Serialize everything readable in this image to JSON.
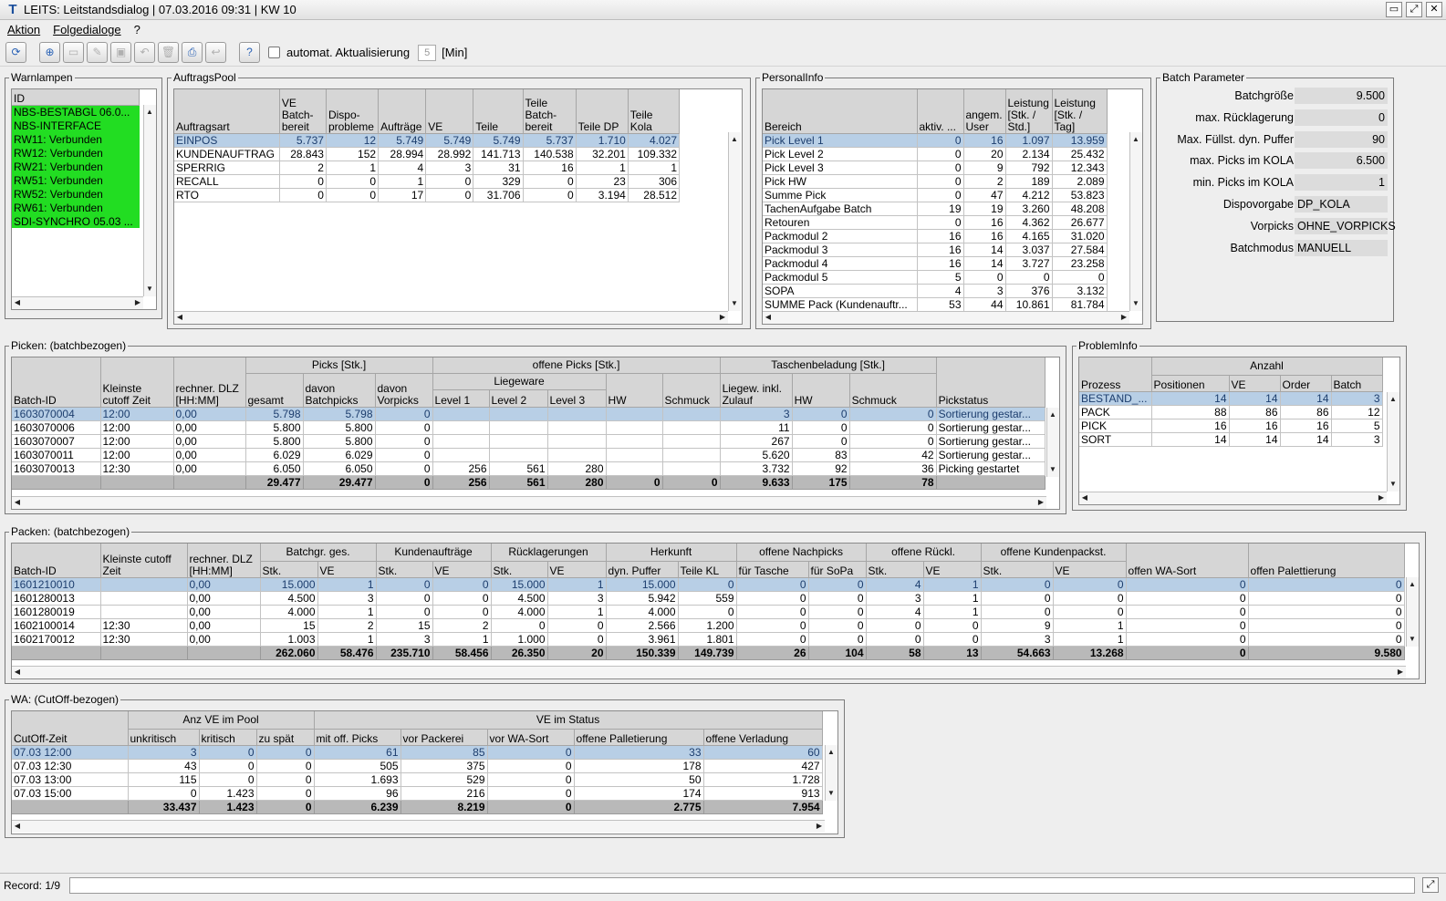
{
  "window": {
    "title": "LEITS: Leitstandsdialog | 07.03.2016 09:31 | KW 10"
  },
  "menu": [
    "Aktion",
    "Folgedialoge",
    "?"
  ],
  "toolbar": {
    "auto_label": "automat. Aktualisierung",
    "interval": "5",
    "unit": "[Min]",
    "buttons": [
      {
        "name": "refresh-icon",
        "glyph": "⟳",
        "enabled": true
      },
      {
        "name": "zoom-icon",
        "glyph": "⊕",
        "enabled": true
      },
      {
        "name": "new-doc-icon",
        "glyph": "▭",
        "enabled": false
      },
      {
        "name": "edit-icon",
        "glyph": "✎",
        "enabled": false
      },
      {
        "name": "save-icon",
        "glyph": "▣",
        "enabled": false
      },
      {
        "name": "undo-icon",
        "glyph": "↶",
        "enabled": false
      },
      {
        "name": "delete-icon",
        "glyph": "🗑",
        "enabled": false
      },
      {
        "name": "print-icon",
        "glyph": "⎙",
        "enabled": true
      },
      {
        "name": "link-icon",
        "glyph": "↩",
        "enabled": false
      },
      {
        "name": "help-icon",
        "glyph": "?",
        "enabled": true
      }
    ]
  },
  "warnlampen": {
    "title": "Warnlampen",
    "header": "ID",
    "items": [
      "NBS-BESTABGL 06.0...",
      "NBS-INTERFACE",
      "RW11: Verbunden",
      "RW12: Verbunden",
      "RW21: Verbunden",
      "RW51: Verbunden",
      "RW52: Verbunden",
      "RW61: Verbunden",
      "SDI-SYNCHRO 05.03 ..."
    ]
  },
  "auftragspool": {
    "title": "AuftragsPool",
    "headers": [
      "Auftragsart",
      "VE Batch-bereit",
      "Dispo-probleme",
      "Aufträge",
      "VE",
      "Teile",
      "Teile Batch-bereit",
      "Teile DP",
      "Teile Kola"
    ],
    "rows": [
      [
        "EINPOS",
        "5.737",
        "12",
        "5.749",
        "5.749",
        "5.749",
        "5.737",
        "1.710",
        "4.027"
      ],
      [
        "KUNDENAUFTRAG",
        "28.843",
        "152",
        "28.994",
        "28.992",
        "141.713",
        "140.538",
        "32.201",
        "109.332"
      ],
      [
        "SPERRIG",
        "2",
        "1",
        "4",
        "3",
        "31",
        "16",
        "1",
        "1"
      ],
      [
        "RECALL",
        "0",
        "0",
        "1",
        "0",
        "329",
        "0",
        "23",
        "306"
      ],
      [
        "RTO",
        "0",
        "0",
        "17",
        "0",
        "31.706",
        "0",
        "3.194",
        "28.512"
      ]
    ]
  },
  "personalinfo": {
    "title": "PersonalInfo",
    "headers": [
      "Bereich",
      "aktiv. ...",
      "angem. User",
      "Leistung [Stk. / Std.]",
      "Leistung [Stk. / Tag]"
    ],
    "rows": [
      [
        "Pick Level 1",
        "0",
        "16",
        "1.097",
        "13.959"
      ],
      [
        "Pick Level 2",
        "0",
        "20",
        "2.134",
        "25.432"
      ],
      [
        "Pick Level 3",
        "0",
        "9",
        "792",
        "12.343"
      ],
      [
        "Pick HW",
        "0",
        "2",
        "189",
        "2.089"
      ],
      [
        "Summe Pick",
        "0",
        "47",
        "4.212",
        "53.823"
      ],
      [
        "TachenAufgabe Batch",
        "19",
        "19",
        "3.260",
        "48.208"
      ],
      [
        "Retouren",
        "0",
        "16",
        "4.362",
        "26.677"
      ],
      [
        "Packmodul 2",
        "16",
        "16",
        "4.165",
        "31.020"
      ],
      [
        "Packmodul 3",
        "16",
        "14",
        "3.037",
        "27.584"
      ],
      [
        "Packmodul 4",
        "16",
        "14",
        "3.727",
        "23.258"
      ],
      [
        "Packmodul 5",
        "5",
        "0",
        "0",
        "0"
      ],
      [
        "SOPA",
        "4",
        "3",
        "376",
        "3.132"
      ],
      [
        "SUMME Pack (Kundenauftr...",
        "53",
        "44",
        "10.861",
        "81.784"
      ]
    ]
  },
  "batchparameter": {
    "title": "Batch Parameter",
    "rows": [
      [
        "Batchgröße",
        "9.500"
      ],
      [
        "max. Rücklagerung",
        "0"
      ],
      [
        "Max. Füllst. dyn. Puffer",
        "90"
      ],
      [
        "max. Picks im KOLA",
        "6.500"
      ],
      [
        "min. Picks im KOLA",
        "1"
      ],
      [
        "Dispovorgabe",
        "DP_KOLA"
      ],
      [
        "Vorpicks",
        "OHNE_VORPICKS"
      ],
      [
        "Batchmodus",
        "MANUELL"
      ]
    ]
  },
  "picken": {
    "title": "Picken: (batchbezogen)",
    "groups": {
      "picks": "Picks [Stk.]",
      "offene": "offene Picks [Stk.]",
      "liegeware": "Liegeware",
      "taschen": "Taschenbeladung [Stk.]"
    },
    "headers": [
      "Batch-ID",
      "Kleinste cutoff Zeit",
      "rechner. DLZ [HH:MM]",
      "gesamt",
      "davon Batchpicks",
      "davon Vorpicks",
      "Level 1",
      "Level 2",
      "Level 3",
      "HW",
      "Schmuck",
      "Liegew. inkl. Zulauf",
      "HW",
      "Schmuck",
      "Pickstatus"
    ],
    "rows": [
      [
        "1603070004",
        "12:00",
        "0,00",
        "5.798",
        "5.798",
        "0",
        "",
        "",
        "",
        "",
        "",
        "3",
        "0",
        "0",
        "Sortierung gestar..."
      ],
      [
        "1603070006",
        "12:00",
        "0,00",
        "5.800",
        "5.800",
        "0",
        "",
        "",
        "",
        "",
        "",
        "11",
        "0",
        "0",
        "Sortierung gestar..."
      ],
      [
        "1603070007",
        "12:00",
        "0,00",
        "5.800",
        "5.800",
        "0",
        "",
        "",
        "",
        "",
        "",
        "267",
        "0",
        "0",
        "Sortierung gestar..."
      ],
      [
        "1603070011",
        "12:00",
        "0,00",
        "6.029",
        "6.029",
        "0",
        "",
        "",
        "",
        "",
        "",
        "5.620",
        "83",
        "42",
        "Sortierung gestar..."
      ],
      [
        "1603070013",
        "12:30",
        "0,00",
        "6.050",
        "6.050",
        "0",
        "256",
        "561",
        "280",
        "",
        "",
        "3.732",
        "92",
        "36",
        "Picking gestartet"
      ]
    ],
    "sum": [
      "",
      "",
      "",
      "29.477",
      "29.477",
      "0",
      "256",
      "561",
      "280",
      "0",
      "0",
      "9.633",
      "175",
      "78",
      ""
    ]
  },
  "probleminfo": {
    "title": "ProblemInfo",
    "group": "Anzahl",
    "headers": [
      "Prozess",
      "Positionen",
      "VE",
      "Order",
      "Batch"
    ],
    "rows": [
      [
        "BESTAND_...",
        "14",
        "14",
        "14",
        "3"
      ],
      [
        "PACK",
        "88",
        "86",
        "86",
        "12"
      ],
      [
        "PICK",
        "16",
        "16",
        "16",
        "5"
      ],
      [
        "SORT",
        "14",
        "14",
        "14",
        "3"
      ]
    ]
  },
  "packen": {
    "title": "Packen: (batchbezogen)",
    "groups": [
      "Batchgr. ges.",
      "Kundenaufträge",
      "Rücklagerungen",
      "Herkunft",
      "offene Nachpicks",
      "offene Rückl.",
      "offene Kundenpackst."
    ],
    "headers": [
      "Batch-ID",
      "Kleinste cutoff Zeit",
      "rechner. DLZ [HH:MM]",
      "Stk.",
      "VE",
      "Stk.",
      "VE",
      "Stk.",
      "VE",
      "dyn. Puffer",
      "Teile KL",
      "für Tasche",
      "für SoPa",
      "Stk.",
      "VE",
      "Stk.",
      "VE",
      "offen WA-Sort",
      "offen Palettierung"
    ],
    "rows": [
      [
        "1601210010",
        "",
        "0,00",
        "15.000",
        "1",
        "0",
        "0",
        "15.000",
        "1",
        "15.000",
        "0",
        "0",
        "0",
        "4",
        "1",
        "0",
        "0",
        "0",
        "0"
      ],
      [
        "1601280013",
        "",
        "0,00",
        "4.500",
        "3",
        "0",
        "0",
        "4.500",
        "3",
        "5.942",
        "559",
        "0",
        "0",
        "3",
        "1",
        "0",
        "0",
        "0",
        "0"
      ],
      [
        "1601280019",
        "",
        "0,00",
        "4.000",
        "1",
        "0",
        "0",
        "4.000",
        "1",
        "4.000",
        "0",
        "0",
        "0",
        "4",
        "1",
        "0",
        "0",
        "0",
        "0"
      ],
      [
        "1602100014",
        "12:30",
        "0,00",
        "15",
        "2",
        "15",
        "2",
        "0",
        "0",
        "2.566",
        "1.200",
        "0",
        "0",
        "0",
        "0",
        "9",
        "1",
        "0",
        "0"
      ],
      [
        "1602170012",
        "12:30",
        "0,00",
        "1.003",
        "1",
        "3",
        "1",
        "1.000",
        "0",
        "3.961",
        "1.801",
        "0",
        "0",
        "0",
        "0",
        "3",
        "1",
        "0",
        "0"
      ]
    ],
    "sum": [
      "",
      "",
      "",
      "262.060",
      "58.476",
      "235.710",
      "58.456",
      "26.350",
      "20",
      "150.339",
      "149.739",
      "26",
      "104",
      "58",
      "13",
      "54.663",
      "13.268",
      "0",
      "9.580"
    ]
  },
  "wa": {
    "title": "WA: (CutOff-bezogen)",
    "groups": [
      "Anz VE im Pool",
      "VE im Status"
    ],
    "headers": [
      "CutOff-Zeit",
      "unkritisch",
      "kritisch",
      "zu spät",
      "mit off. Picks",
      "vor Packerei",
      "vor WA-Sort",
      "offene Palletierung",
      "offene Verladung"
    ],
    "rows": [
      [
        "07.03 12:00",
        "3",
        "0",
        "0",
        "61",
        "85",
        "0",
        "33",
        "60"
      ],
      [
        "07.03 12:30",
        "43",
        "0",
        "0",
        "505",
        "375",
        "0",
        "178",
        "427"
      ],
      [
        "07.03 13:00",
        "115",
        "0",
        "0",
        "1.693",
        "529",
        "0",
        "50",
        "1.728"
      ],
      [
        "07.03 15:00",
        "0",
        "1.423",
        "0",
        "96",
        "216",
        "0",
        "174",
        "913"
      ]
    ],
    "sum": [
      "",
      "33.437",
      "1.423",
      "0",
      "6.239",
      "8.219",
      "0",
      "2.775",
      "7.954"
    ]
  },
  "status": {
    "record": "Record: 1/9"
  }
}
